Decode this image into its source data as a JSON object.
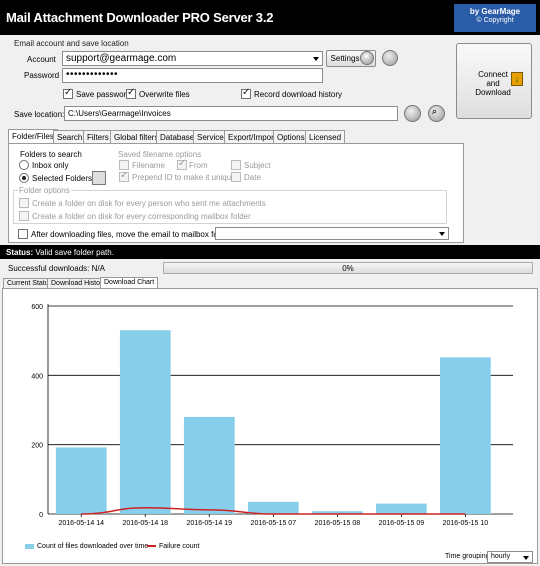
{
  "window": {
    "title": "Mail Attachment Downloader PRO Server 3.2",
    "brand_line1": "by GearMage",
    "brand_line2": "© Copyright"
  },
  "account": {
    "group_title": "Email account and save location",
    "account_label": "Account",
    "account_value": "support@gearmage.com",
    "password_label": "Password",
    "password_value": "•••••••••••••",
    "settings_label": "Settings",
    "save_password_label": "Save password",
    "save_password_checked": true,
    "overwrite_files_label": "Overwrite files",
    "overwrite_files_checked": true,
    "record_history_label": "Record download history",
    "record_history_checked": true,
    "save_location_label": "Save location:",
    "save_location_value": "C:\\Users\\Gearmage\\Invoices"
  },
  "connect": {
    "label": "Connect and Download",
    "line1": "Connect",
    "line2": "and",
    "line3": "Download"
  },
  "tabs": [
    "Folder/Files",
    "Search",
    "Filters",
    "Global filters",
    "Database",
    "Service",
    "Export/Import",
    "Options",
    "Licensed"
  ],
  "folder_files": {
    "folders_to_search_label": "Folders to search",
    "inbox_only_label": "Inbox only",
    "selected_folders_label": "Selected Folders",
    "saved_filename_label": "Saved filename options",
    "filename_label": "Filename",
    "from_label": "From",
    "subject_label": "Subject",
    "prepend_label": "Prepend ID to make it unique",
    "date_label": "Date",
    "folder_options_label": "Folder options",
    "create_person_label": "Create a folder on disk for every person who sent me attachments",
    "create_mailbox_label": "Create a folder on disk for every corresponding mailbox folder",
    "after_download_label": "After downloading files, move the email to mailbox folder",
    "after_download_value": ""
  },
  "status": {
    "prefix": "Status:",
    "text": "Valid save folder path."
  },
  "downloads": {
    "label": "Successful downloads: N/A",
    "progress_text": "0%",
    "progress_value": 0
  },
  "bottom_tabs": [
    "Current Status",
    "Download History",
    "Download Chart"
  ],
  "time_grouping": {
    "label": "Time grouping",
    "value": "hourly"
  },
  "chart_data": {
    "type": "bar",
    "categories": [
      "2016-05-14 14",
      "2016-05-14 18",
      "2016-05-14 19",
      "2016-05-15 07",
      "2016-05-15 08",
      "2016-05-15 09",
      "2016-05-15 10"
    ],
    "series": [
      {
        "name": "Count of files downloaded over time",
        "type": "bar",
        "color": "#87ceeb",
        "values": [
          192,
          530,
          280,
          35,
          8,
          30,
          452
        ]
      },
      {
        "name": "Failure count",
        "type": "line",
        "color": "#cc2222",
        "values": [
          0,
          18,
          12,
          0,
          0,
          0,
          0
        ]
      }
    ],
    "yticks": [
      "0",
      "200",
      "400",
      "600"
    ],
    "ylim": [
      0,
      600
    ],
    "grid": true,
    "legend": "bottom-left"
  }
}
